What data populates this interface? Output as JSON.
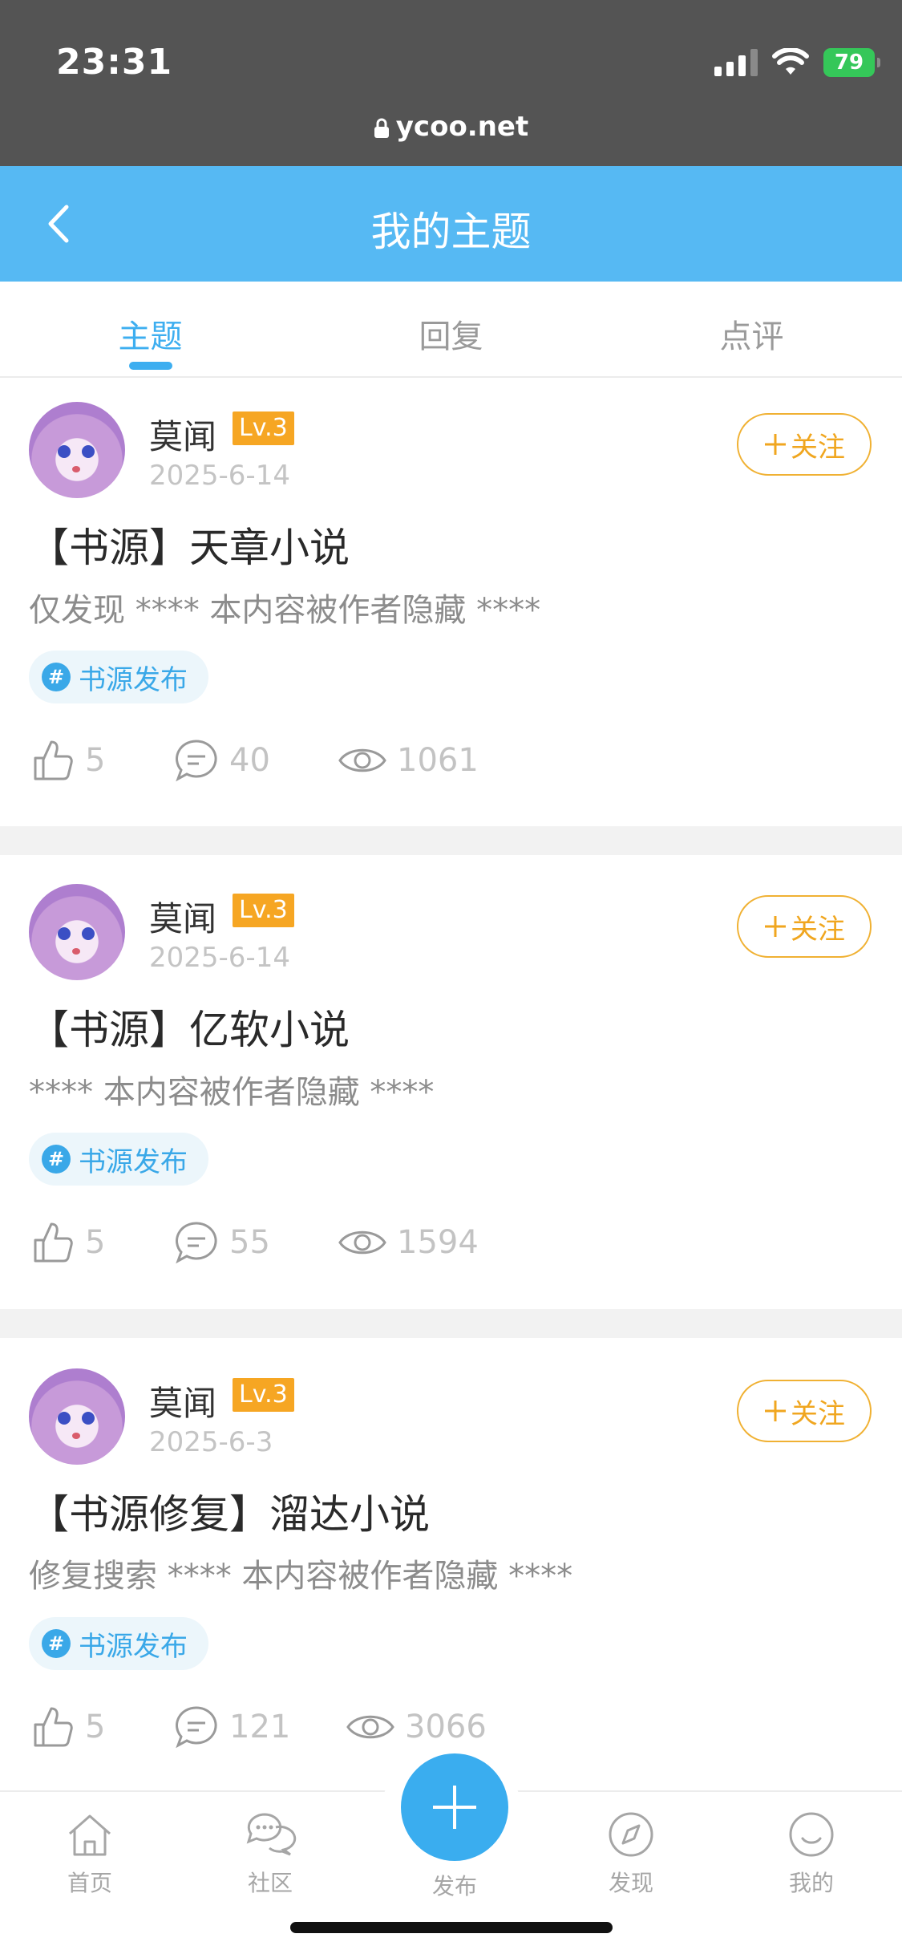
{
  "status_bar": {
    "time": "23:31",
    "battery": "79",
    "url": "ycoo.net"
  },
  "header": {
    "title": "我的主题"
  },
  "tabs": [
    {
      "label": "主题",
      "active": true
    },
    {
      "label": "回复",
      "active": false
    },
    {
      "label": "点评",
      "active": false
    }
  ],
  "posts": [
    {
      "username": "莫闻",
      "level": "Lv.3",
      "date": "2025-6-14",
      "follow_label": "关注",
      "title": "【书源】天章小说",
      "excerpt": "仅发现 **** 本内容被作者隐藏 ****",
      "tag": "书源发布",
      "likes": "5",
      "comments": "40",
      "views": "1061"
    },
    {
      "username": "莫闻",
      "level": "Lv.3",
      "date": "2025-6-14",
      "follow_label": "关注",
      "title": "【书源】亿软小说",
      "excerpt": "**** 本内容被作者隐藏 ****",
      "tag": "书源发布",
      "likes": "5",
      "comments": "55",
      "views": "1594"
    },
    {
      "username": "莫闻",
      "level": "Lv.3",
      "date": "2025-6-3",
      "follow_label": "关注",
      "title": "【书源修复】溜达小说",
      "excerpt": "修复搜索 **** 本内容被作者隐藏 ****",
      "tag": "书源发布",
      "likes": "5",
      "comments": "121",
      "views": "3066"
    }
  ],
  "bottom_nav": {
    "home": "首页",
    "community": "社区",
    "publish": "发布",
    "discover": "发现",
    "mine": "我的"
  },
  "colors": {
    "accent": "#56b9f3",
    "follow": "#f0a61f",
    "level_badge": "#f6a623"
  }
}
